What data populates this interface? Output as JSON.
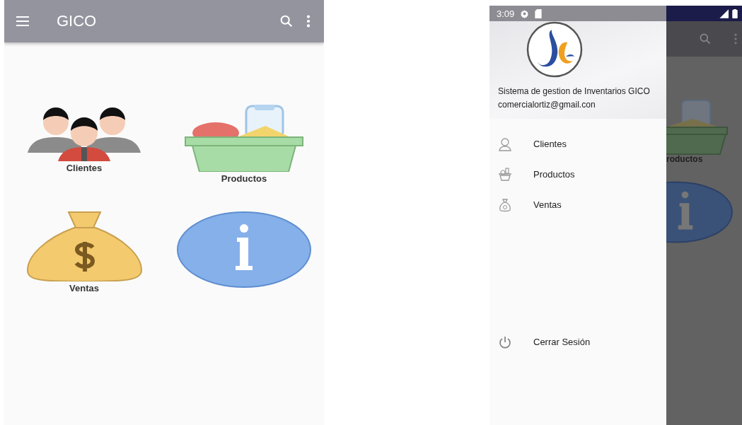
{
  "main_screen": {
    "app_bar": {
      "title": "GICO"
    },
    "tiles": [
      {
        "kind": "clients",
        "label": "Clientes"
      },
      {
        "kind": "products",
        "label": "Productos"
      },
      {
        "kind": "sales",
        "label": "Ventas"
      },
      {
        "kind": "info"
      }
    ]
  },
  "drawer_screen": {
    "status_bar": {
      "time": "3:09"
    },
    "header": {
      "title": "Sistema de gestion de Inventarios GICO",
      "email": "comercialortiz@gmail.con"
    },
    "menu": [
      {
        "kind": "clients",
        "label": "Clientes"
      },
      {
        "kind": "products",
        "label": "Productos"
      },
      {
        "kind": "sales",
        "label": "Ventas"
      }
    ],
    "footer_item": {
      "kind": "logout",
      "label": "Cerrar Sesión"
    },
    "background_label": "roductos"
  }
}
